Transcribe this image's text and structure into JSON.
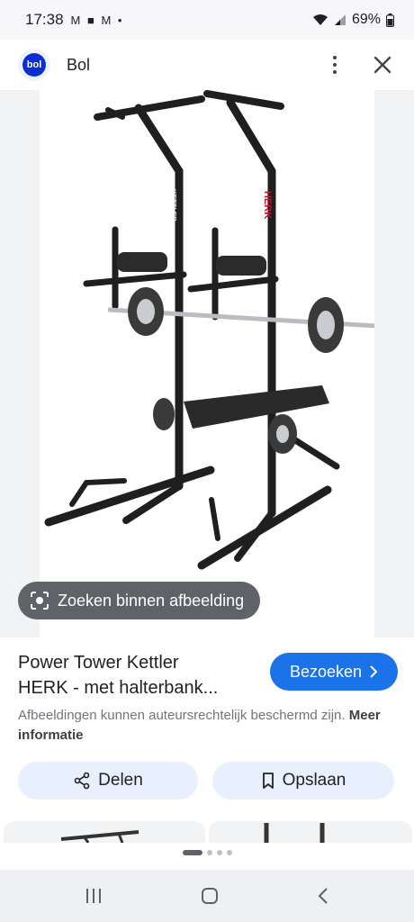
{
  "status_bar": {
    "time": "17:38",
    "notifications": "M ■ M •",
    "battery": "69%"
  },
  "app_bar": {
    "source": "Bol",
    "logo_text": "bol"
  },
  "image": {
    "brand_mark": "KETTLER",
    "model_mark": "HERK"
  },
  "lens": {
    "label": "Zoeken binnen afbeelding"
  },
  "result": {
    "title_line1": "Power Tower Kettler",
    "title_line2": "HERK - met halterbank...",
    "visit_label": "Bezoeken"
  },
  "notice": {
    "text": "Afbeeldingen kunnen auteursrechtelijk beschermd zijn.",
    "link": "Meer informatie"
  },
  "actions": {
    "share_label": "Delen",
    "save_label": "Opslaan"
  },
  "pager": {
    "total": 4,
    "active": 0
  },
  "colors": {
    "accent": "#1a73e8",
    "chip": "#e8f0fe",
    "lens_chip": "#5f6368",
    "brand": "#0a2ed1",
    "herk_label": "#c8102e"
  }
}
